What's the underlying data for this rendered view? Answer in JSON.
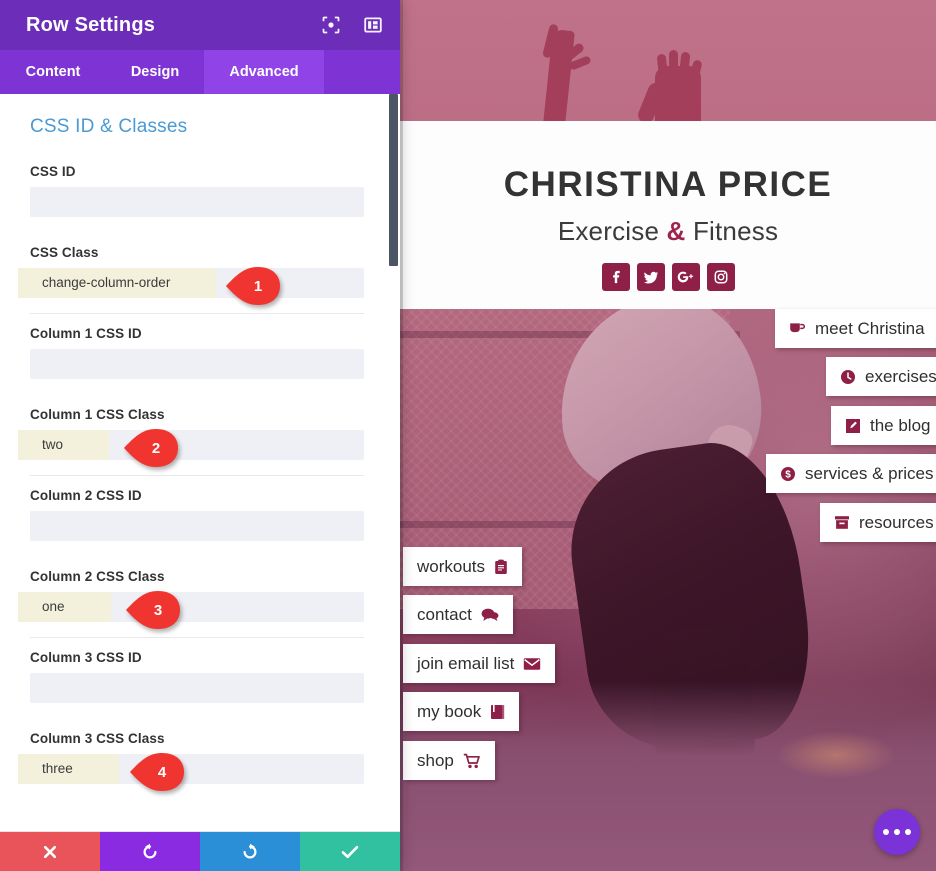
{
  "settings": {
    "title": "Row Settings",
    "header_icons": [
      {
        "name": "focus-icon"
      },
      {
        "name": "layout-panel-icon"
      }
    ],
    "tabs": [
      {
        "label": "Content",
        "active": false
      },
      {
        "label": "Design",
        "active": false
      },
      {
        "label": "Advanced",
        "active": true
      }
    ],
    "section_title": "CSS ID & Classes",
    "fields": [
      {
        "label": "CSS ID",
        "value": "",
        "placeholder": "",
        "divider": false
      },
      {
        "label": "CSS Class",
        "value": "change-column-order",
        "placeholder": "",
        "divider": true,
        "callout": "1"
      },
      {
        "label": "Column 1 CSS ID",
        "value": "",
        "placeholder": "",
        "divider": false
      },
      {
        "label": "Column 1 CSS Class",
        "value": "two",
        "placeholder": "",
        "divider": true,
        "callout": "2"
      },
      {
        "label": "Column 2 CSS ID",
        "value": "",
        "placeholder": "",
        "divider": false
      },
      {
        "label": "Column 2 CSS Class",
        "value": "one",
        "placeholder": "",
        "divider": true,
        "callout": "3"
      },
      {
        "label": "Column 3 CSS ID",
        "value": "",
        "placeholder": "",
        "divider": false
      },
      {
        "label": "Column 3 CSS Class",
        "value": "three",
        "placeholder": "",
        "divider": false,
        "callout": "4"
      }
    ],
    "footer_buttons": [
      {
        "name": "close-button",
        "icon": "close-icon",
        "color": "#e8545a"
      },
      {
        "name": "undo-button",
        "icon": "undo-icon",
        "color": "#8a2be2"
      },
      {
        "name": "redo-button",
        "icon": "redo-icon",
        "color": "#2b8fd8"
      },
      {
        "name": "save-button",
        "icon": "check-icon",
        "color": "#31c0a0"
      }
    ],
    "accent_color": "#6c2eb9",
    "tab_active_color": "#9044e8",
    "section_title_color": "#4a9ad4",
    "input_bg": "#eef0f5",
    "input_highlight": "#f3f1dc",
    "callout_color": "#f0342f"
  },
  "preview": {
    "brand_name": "CHRISTINA PRICE",
    "tagline_before": "Exercise ",
    "tagline_amp": "&",
    "tagline_after": " Fitness",
    "brand_color": "#8e1f46",
    "socials": [
      {
        "name": "facebook-icon",
        "label": "f"
      },
      {
        "name": "twitter-icon",
        "label": "t"
      },
      {
        "name": "google-plus-icon",
        "label": "G+"
      },
      {
        "name": "instagram-icon",
        "label": "ig"
      }
    ],
    "right_menu": [
      {
        "label": "meet Christina",
        "icon": "coffee-icon"
      },
      {
        "label": "exercises",
        "icon": "clock-icon"
      },
      {
        "label": "the blog",
        "icon": "pencil-icon"
      },
      {
        "label": "services & prices",
        "icon": "dollar-circle-icon"
      },
      {
        "label": "resources",
        "icon": "archive-icon"
      }
    ],
    "left_menu": [
      {
        "label": "workouts",
        "icon": "clipboard-icon"
      },
      {
        "label": "contact",
        "icon": "chat-icon"
      },
      {
        "label": "join email list",
        "icon": "envelope-icon"
      },
      {
        "label": "my book",
        "icon": "book-icon"
      },
      {
        "label": "shop",
        "icon": "cart-icon"
      }
    ],
    "fab": {
      "name": "more-options-button",
      "icon": "ellipsis-icon"
    }
  }
}
